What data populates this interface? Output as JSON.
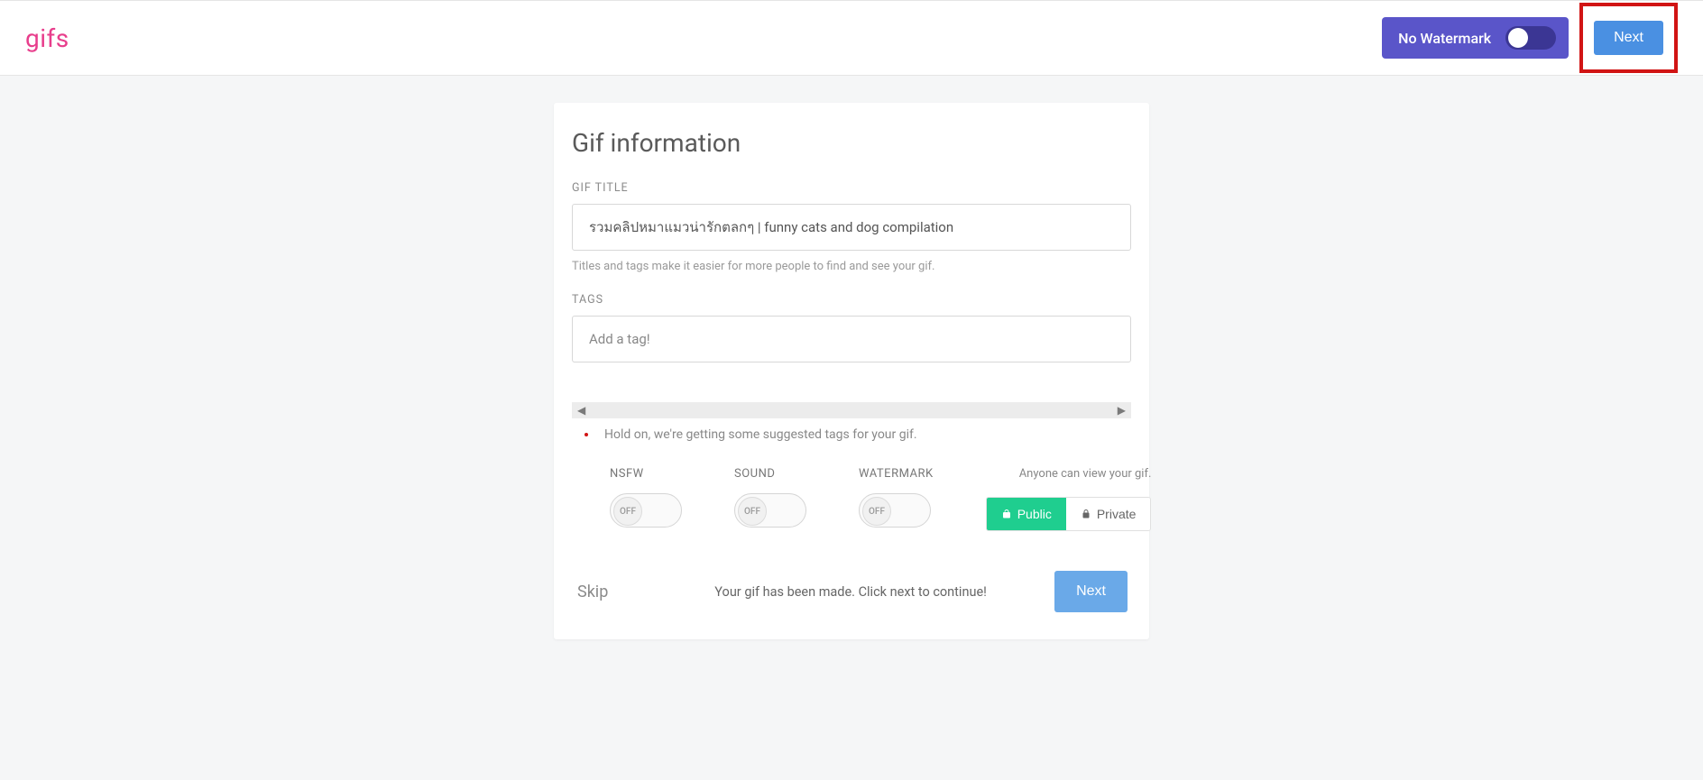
{
  "header": {
    "logo": "gifs",
    "watermark_label": "No Watermark",
    "next_label": "Next"
  },
  "card": {
    "title": "Gif information",
    "title_label": "GIF TITLE",
    "title_value": "รวมคลิปหมาแมวน่ารักตลกๆ | funny cats and dog compilation",
    "helper": "Titles and tags make it easier for more people to find and see your gif.",
    "tags_label": "TAGS",
    "tags_placeholder": "Add a tag!",
    "loading_text": "Hold on, we're getting some suggested tags for your gif.",
    "toggles": {
      "nsfw": {
        "label": "NSFW",
        "state": "OFF"
      },
      "sound": {
        "label": "SOUND",
        "state": "OFF"
      },
      "watermark": {
        "label": "WATERMARK",
        "state": "OFF"
      }
    },
    "visibility": {
      "hint": "Anyone can view your gif.",
      "public": "Public",
      "private": "Private"
    },
    "footer": {
      "skip": "Skip",
      "made": "Your gif has been made. Click next to continue!",
      "next": "Next"
    }
  }
}
